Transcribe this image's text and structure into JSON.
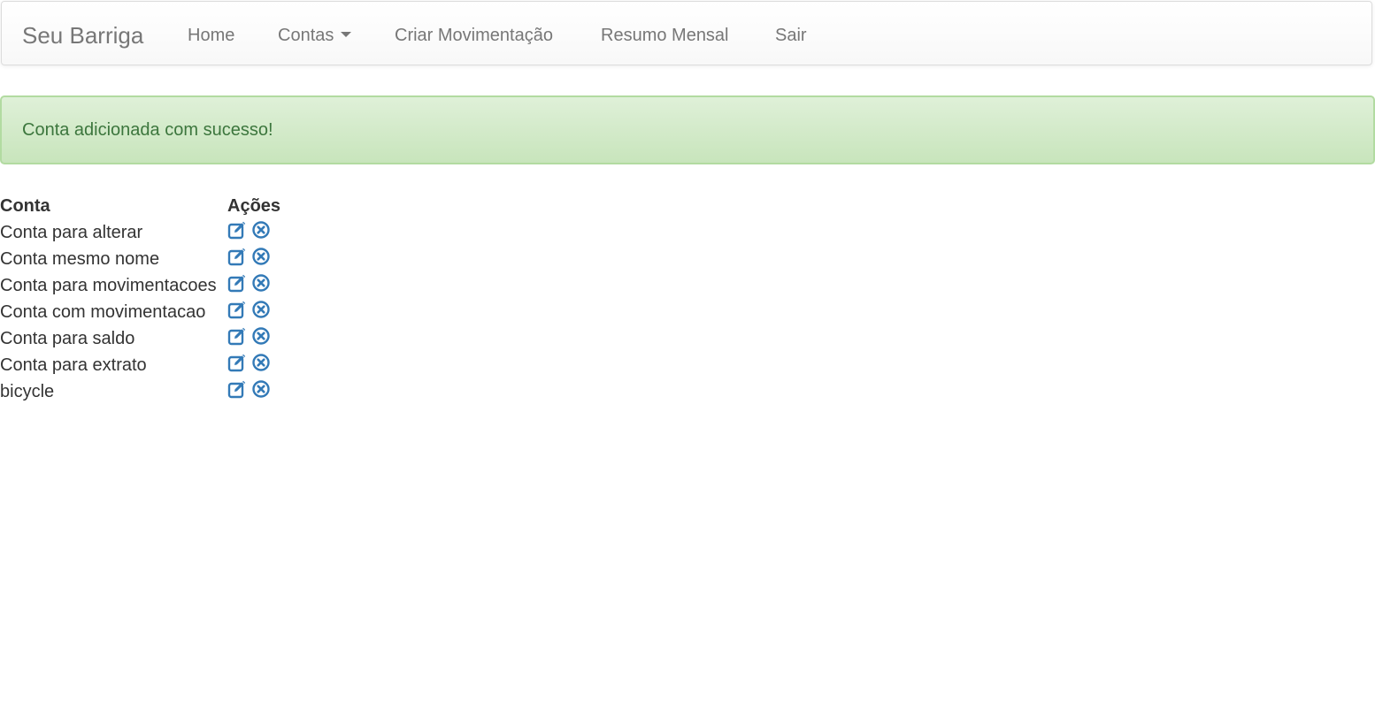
{
  "navbar": {
    "brand": "Seu Barriga",
    "items": [
      {
        "label": "Home"
      },
      {
        "label": "Contas",
        "dropdown": true
      },
      {
        "label": "Criar Movimentação"
      },
      {
        "label": "Resumo Mensal"
      },
      {
        "label": "Sair"
      }
    ]
  },
  "alert": {
    "message": "Conta adicionada com sucesso!",
    "color": "#3c763d"
  },
  "table": {
    "headers": [
      "Conta",
      "Ações"
    ],
    "rows": [
      {
        "name": "Conta para alterar",
        "actions": [
          "edit-icon",
          "remove-icon"
        ]
      },
      {
        "name": "Conta mesmo nome",
        "actions": [
          "edit-icon",
          "remove-icon"
        ]
      },
      {
        "name": "Conta para movimentacoes",
        "actions": [
          "edit-icon",
          "remove-icon"
        ]
      },
      {
        "name": "Conta com movimentacao",
        "actions": [
          "edit-icon",
          "remove-icon"
        ]
      },
      {
        "name": "Conta para saldo",
        "actions": [
          "edit-icon",
          "remove-icon"
        ]
      },
      {
        "name": "Conta para extrato",
        "actions": [
          "edit-icon",
          "remove-icon"
        ]
      },
      {
        "name": "bicycle",
        "actions": [
          "edit-icon",
          "remove-icon"
        ]
      }
    ]
  },
  "colors": {
    "icon": "#337ab7",
    "nav_text": "#777777"
  }
}
